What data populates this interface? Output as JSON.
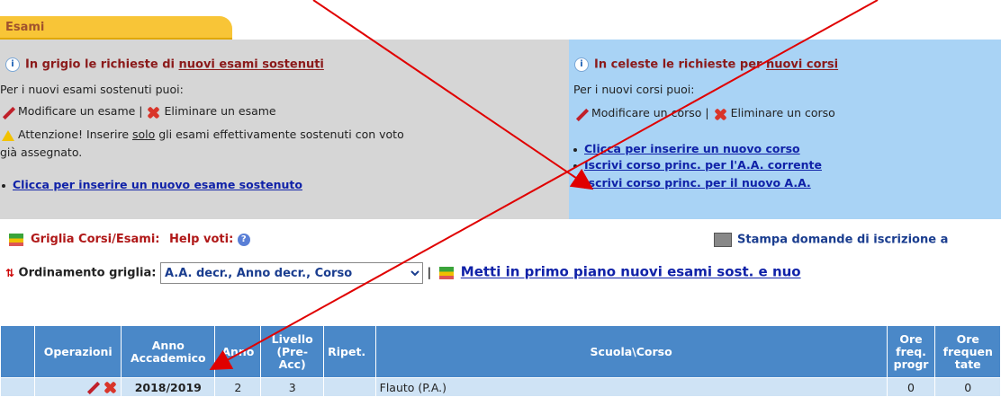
{
  "tab": {
    "label": "Esami"
  },
  "gray_panel": {
    "title_prefix": "In grigio le richieste di ",
    "title_link": "nuovi esami sostenuti",
    "intro": "Per i nuovi esami sostenuti puoi:",
    "modify_label": "Modificare un esame |",
    "delete_label": "Eliminare un esame",
    "warn_prefix": "Attenzione! Inserire ",
    "warn_underlined": "solo",
    "warn_suffix": " gli esami effettivamente sostenuti con voto",
    "warn_line2": "già assegnato.",
    "add_link": "Clicca per inserire un nuovo esame sostenuto"
  },
  "blue_panel": {
    "title_prefix": "In celeste le richieste per ",
    "title_link": "nuovi corsi",
    "intro": "Per i nuovi corsi puoi:",
    "modify_label": "Modificare un corso |",
    "delete_label": "Eliminare un corso",
    "links": [
      "Clicca per inserire un nuovo corso",
      "Iscrivi corso princ. per l'A.A. corrente",
      "Iscrivi corso princ. per il nuovo A.A."
    ]
  },
  "grid_bar": {
    "label": "Griglia Corsi/Esami:",
    "help_label": "Help voti:",
    "print_link": "Stampa domande di iscrizione a"
  },
  "sort_bar": {
    "label": "Ordinamento griglia:",
    "selected": "A.A. decr., Anno decr., Corso",
    "separator": "|",
    "front_link": "Metti in primo piano nuovi esami sost. e nuo"
  },
  "table": {
    "headers": [
      "",
      "Operazioni",
      "Anno Accademico",
      "Anno",
      "Livello (Pre-Acc)",
      "Ripet.",
      "Scuola\\Corso",
      "Ore freq. progr",
      "Ore frequen tate"
    ],
    "rows": [
      {
        "anno_accademico": "2018/2019",
        "anno": "2",
        "livello": "3",
        "ripet": "",
        "corso": "Flauto (P.A.)",
        "ore_progr": "0",
        "ore_freq": "0"
      }
    ]
  },
  "colors": {
    "tab": "#f8c537",
    "gray_panel": "#d6d6d6",
    "blue_panel": "#a9d3f5",
    "header": "#4a88c8",
    "arrow": "#e00000"
  }
}
